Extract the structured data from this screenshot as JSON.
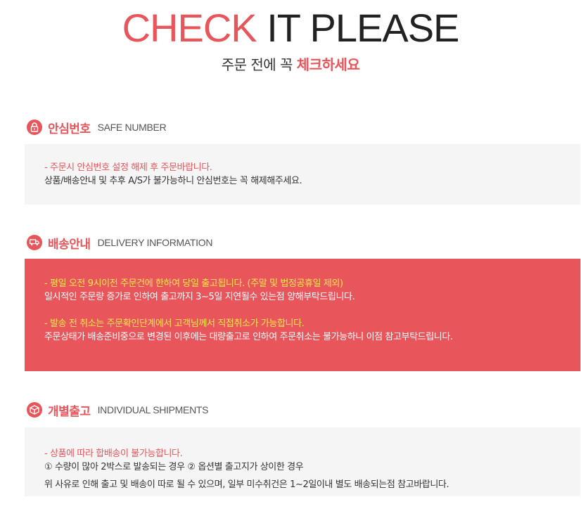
{
  "header": {
    "title_red": "CHECK",
    "title_dark": "IT PLEASE",
    "subtitle_plain": "주문 전에 꼭",
    "subtitle_highlight": "체크하세요"
  },
  "sections": [
    {
      "title": "안심번호",
      "title_en": "SAFE NUMBER",
      "icon": "lock-icon",
      "lines": [
        "- 주문시 안심번호 설정 해제 후 주문바랍니다.",
        "상품/배송안내 및 추후 A/S가 불가능하니 안심번호는 꼭 해제해주세요."
      ]
    },
    {
      "title": "배송안내",
      "title_en": "DELIVERY INFORMATION",
      "icon": "truck-icon",
      "lines": [
        "- 평일 오전 9시이전 주문건에 한하여 당일 출고됩니다. (주말 및 법정공휴일 제외)",
        "일시적인 주문량 증가로 인하여 출고까지 3~5일 지연될수 있는점 양해부탁드립니다.",
        "- 발송 전 취소는 주문확인단계에서 고객님께서 직접취소가 가능합니다.",
        "주문상태가 배송준비중으로 변경된 이후에는 대량출고로 인하여 주문취소는 불가능하니 이점 참고부탁드립니다."
      ]
    },
    {
      "title": "개별출고",
      "title_en": "INDIVIDUAL SHIPMENTS",
      "icon": "box-icon",
      "lines": [
        "- 상품에 따라 합배송이 불가능합니다.",
        "① 수량이 많아 2박스로 발송되는 경우 ② 옵션별 출고지가 상이한 경우",
        "위 사유로 인해 출고 및 배송이 따로 될 수 있으며, 일부 미수취건은 1~2일이내 별도 배송되는점 참고바랍니다."
      ]
    }
  ],
  "colors": {
    "accent": "#e8555a",
    "highlight_yellow": "#ffe94d",
    "box_gray": "#f5f5f5"
  }
}
